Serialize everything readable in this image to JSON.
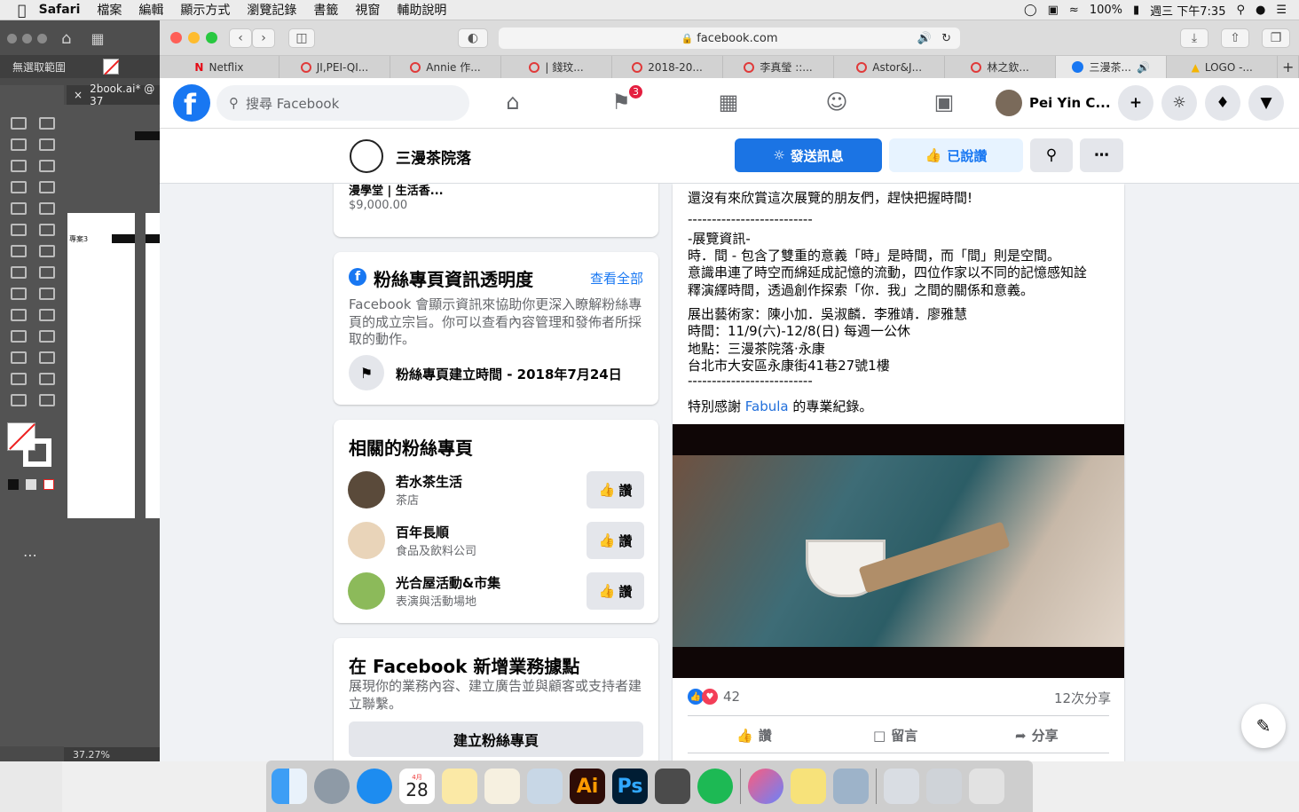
{
  "menubar": {
    "app": "Safari",
    "items": [
      "檔案",
      "編輯",
      "顯示方式",
      "瀏覽記錄",
      "書籤",
      "視窗",
      "輔助說明"
    ],
    "battery": "100%",
    "clock": "週三 下午7:35"
  },
  "illustrator": {
    "selection_label": "無選取範圍",
    "doc_tab": "2book.ai* @ 37",
    "artboard_text": "專案3",
    "zoom": "37.27%"
  },
  "safari": {
    "url": "facebook.com",
    "tabs": [
      "Netflix",
      "JI,PEI-QI...",
      "Annie 作...",
      "| 錢玟...",
      "2018-20...",
      "李真瑩 ::...",
      "Astor&J...",
      "林之欽...",
      "三漫茶...",
      "LOGO -..."
    ],
    "active_tab": 8
  },
  "fb": {
    "logo": "f",
    "search_placeholder": "搜尋 Facebook",
    "notif_count": "3",
    "profile_name": "Pei Yin C...",
    "page_name": "三漫茶院落",
    "message_btn": "發送訊息",
    "liked_btn": "已說讚"
  },
  "left": {
    "product_title": "漫學堂 | 生活香...",
    "product_price": "$9,000.00",
    "transparency": {
      "title": "粉絲專頁資訊透明度",
      "see_all": "查看全部",
      "desc": "Facebook 會顯示資訊來協助你更深入瞭解粉絲專頁的成立宗旨。你可以查看內容管理和發佈者所採取的動作。",
      "created": "粉絲專頁建立時間 - 2018年7月24日"
    },
    "related": {
      "title": "相關的粉絲專頁",
      "items": [
        {
          "name": "若水茶生活",
          "category": "茶店"
        },
        {
          "name": "百年長順",
          "category": "食品及飲料公司"
        },
        {
          "name": "光合屋活動&市集",
          "category": "表演與活動場地"
        }
      ],
      "like_label": "讚"
    },
    "business": {
      "title": "在 Facebook 新增業務據點",
      "desc": "展現你的業務內容、建立廣告並與顧客或支持者建立聯繫。",
      "button": "建立粉絲專頁"
    }
  },
  "post": {
    "lines": [
      "還沒有來欣賞這次展覽的朋友們，趕快把握時間!",
      "--------------------------",
      "-展覽資訊-",
      "時．間 - 包含了雙重的意義「時」是時間，而「間」則是空間。",
      "意識串連了時空而綿延成記憶的流動，四位作家以不同的記憶感知詮",
      "釋演繹時間，透過創作探索「你．我」之間的關係和意義。",
      "展出藝術家：陳小加．吳淑麟．李雅靖．廖雅慧",
      "時間：11/9(六)-12/8(日) 每週一公休",
      "地點：三漫茶院落·永康",
      "台北市大安區永康街41巷27號1樓",
      "--------------------------"
    ],
    "thanks_pre": "特別感謝 ",
    "thanks_link": "Fabula",
    "thanks_post": " 的專業紀錄。",
    "reactions": "42",
    "shares": "12次分享",
    "actions": [
      "讚",
      "留言",
      "分享"
    ]
  },
  "dock": {
    "calendar_month": "4月",
    "calendar_day": "28"
  }
}
